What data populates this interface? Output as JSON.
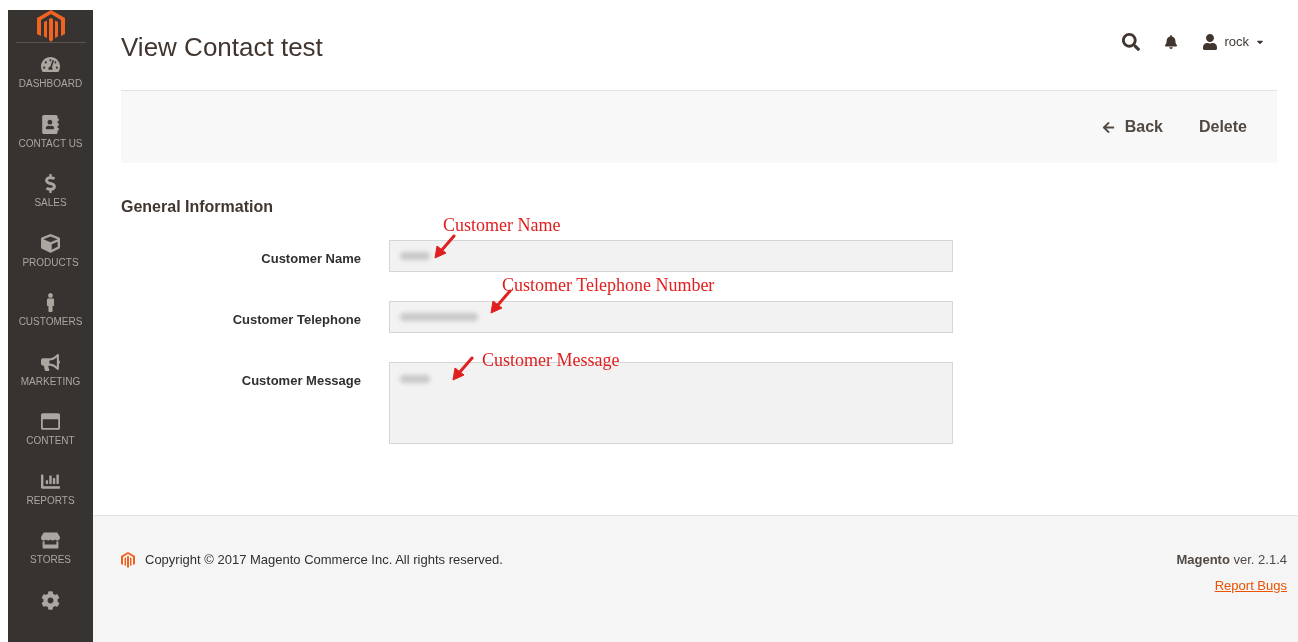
{
  "sidebar": {
    "items": [
      {
        "kind": "dashboard",
        "label": "DASHBOARD"
      },
      {
        "kind": "contact",
        "label": "CONTACT US"
      },
      {
        "kind": "sales",
        "label": "SALES"
      },
      {
        "kind": "products",
        "label": "PRODUCTS"
      },
      {
        "kind": "customers",
        "label": "CUSTOMERS"
      },
      {
        "kind": "marketing",
        "label": "MARKETING"
      },
      {
        "kind": "content",
        "label": "CONTENT"
      },
      {
        "kind": "reports",
        "label": "REPORTS"
      },
      {
        "kind": "stores",
        "label": "STORES"
      },
      {
        "kind": "settings"
      }
    ]
  },
  "header": {
    "title": "View Contact test",
    "user": "rock"
  },
  "actions": [
    {
      "kind": "back",
      "label": "Back"
    },
    {
      "kind": "plain",
      "label": "Delete"
    }
  ],
  "section": {
    "title": "General Information",
    "fields": [
      {
        "kind": "input",
        "label": "Customer Name",
        "annotation": "Customer Name"
      },
      {
        "kind": "input",
        "label": "Customer Telephone",
        "annotation": "Customer Telephone Number"
      },
      {
        "kind": "textarea",
        "label": "Customer Message",
        "annotation": "Customer Message"
      }
    ]
  },
  "footer": {
    "copyright": "Copyright © 2017 Magento Commerce Inc. All rights reserved.",
    "version": "**Magento** ver. 2.1.4",
    "link": "Report Bugs"
  }
}
